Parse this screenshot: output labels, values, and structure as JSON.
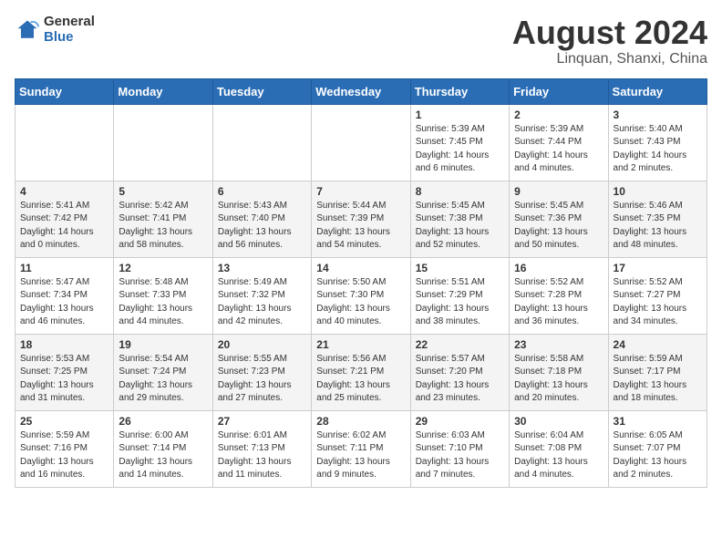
{
  "header": {
    "logo_general": "General",
    "logo_blue": "Blue",
    "month_title": "August 2024",
    "location": "Linquan, Shanxi, China"
  },
  "weekdays": [
    "Sunday",
    "Monday",
    "Tuesday",
    "Wednesday",
    "Thursday",
    "Friday",
    "Saturday"
  ],
  "weeks": [
    [
      {
        "day": "",
        "info": ""
      },
      {
        "day": "",
        "info": ""
      },
      {
        "day": "",
        "info": ""
      },
      {
        "day": "",
        "info": ""
      },
      {
        "day": "1",
        "info": "Sunrise: 5:39 AM\nSunset: 7:45 PM\nDaylight: 14 hours\nand 6 minutes."
      },
      {
        "day": "2",
        "info": "Sunrise: 5:39 AM\nSunset: 7:44 PM\nDaylight: 14 hours\nand 4 minutes."
      },
      {
        "day": "3",
        "info": "Sunrise: 5:40 AM\nSunset: 7:43 PM\nDaylight: 14 hours\nand 2 minutes."
      }
    ],
    [
      {
        "day": "4",
        "info": "Sunrise: 5:41 AM\nSunset: 7:42 PM\nDaylight: 14 hours\nand 0 minutes."
      },
      {
        "day": "5",
        "info": "Sunrise: 5:42 AM\nSunset: 7:41 PM\nDaylight: 13 hours\nand 58 minutes."
      },
      {
        "day": "6",
        "info": "Sunrise: 5:43 AM\nSunset: 7:40 PM\nDaylight: 13 hours\nand 56 minutes."
      },
      {
        "day": "7",
        "info": "Sunrise: 5:44 AM\nSunset: 7:39 PM\nDaylight: 13 hours\nand 54 minutes."
      },
      {
        "day": "8",
        "info": "Sunrise: 5:45 AM\nSunset: 7:38 PM\nDaylight: 13 hours\nand 52 minutes."
      },
      {
        "day": "9",
        "info": "Sunrise: 5:45 AM\nSunset: 7:36 PM\nDaylight: 13 hours\nand 50 minutes."
      },
      {
        "day": "10",
        "info": "Sunrise: 5:46 AM\nSunset: 7:35 PM\nDaylight: 13 hours\nand 48 minutes."
      }
    ],
    [
      {
        "day": "11",
        "info": "Sunrise: 5:47 AM\nSunset: 7:34 PM\nDaylight: 13 hours\nand 46 minutes."
      },
      {
        "day": "12",
        "info": "Sunrise: 5:48 AM\nSunset: 7:33 PM\nDaylight: 13 hours\nand 44 minutes."
      },
      {
        "day": "13",
        "info": "Sunrise: 5:49 AM\nSunset: 7:32 PM\nDaylight: 13 hours\nand 42 minutes."
      },
      {
        "day": "14",
        "info": "Sunrise: 5:50 AM\nSunset: 7:30 PM\nDaylight: 13 hours\nand 40 minutes."
      },
      {
        "day": "15",
        "info": "Sunrise: 5:51 AM\nSunset: 7:29 PM\nDaylight: 13 hours\nand 38 minutes."
      },
      {
        "day": "16",
        "info": "Sunrise: 5:52 AM\nSunset: 7:28 PM\nDaylight: 13 hours\nand 36 minutes."
      },
      {
        "day": "17",
        "info": "Sunrise: 5:52 AM\nSunset: 7:27 PM\nDaylight: 13 hours\nand 34 minutes."
      }
    ],
    [
      {
        "day": "18",
        "info": "Sunrise: 5:53 AM\nSunset: 7:25 PM\nDaylight: 13 hours\nand 31 minutes."
      },
      {
        "day": "19",
        "info": "Sunrise: 5:54 AM\nSunset: 7:24 PM\nDaylight: 13 hours\nand 29 minutes."
      },
      {
        "day": "20",
        "info": "Sunrise: 5:55 AM\nSunset: 7:23 PM\nDaylight: 13 hours\nand 27 minutes."
      },
      {
        "day": "21",
        "info": "Sunrise: 5:56 AM\nSunset: 7:21 PM\nDaylight: 13 hours\nand 25 minutes."
      },
      {
        "day": "22",
        "info": "Sunrise: 5:57 AM\nSunset: 7:20 PM\nDaylight: 13 hours\nand 23 minutes."
      },
      {
        "day": "23",
        "info": "Sunrise: 5:58 AM\nSunset: 7:18 PM\nDaylight: 13 hours\nand 20 minutes."
      },
      {
        "day": "24",
        "info": "Sunrise: 5:59 AM\nSunset: 7:17 PM\nDaylight: 13 hours\nand 18 minutes."
      }
    ],
    [
      {
        "day": "25",
        "info": "Sunrise: 5:59 AM\nSunset: 7:16 PM\nDaylight: 13 hours\nand 16 minutes."
      },
      {
        "day": "26",
        "info": "Sunrise: 6:00 AM\nSunset: 7:14 PM\nDaylight: 13 hours\nand 14 minutes."
      },
      {
        "day": "27",
        "info": "Sunrise: 6:01 AM\nSunset: 7:13 PM\nDaylight: 13 hours\nand 11 minutes."
      },
      {
        "day": "28",
        "info": "Sunrise: 6:02 AM\nSunset: 7:11 PM\nDaylight: 13 hours\nand 9 minutes."
      },
      {
        "day": "29",
        "info": "Sunrise: 6:03 AM\nSunset: 7:10 PM\nDaylight: 13 hours\nand 7 minutes."
      },
      {
        "day": "30",
        "info": "Sunrise: 6:04 AM\nSunset: 7:08 PM\nDaylight: 13 hours\nand 4 minutes."
      },
      {
        "day": "31",
        "info": "Sunrise: 6:05 AM\nSunset: 7:07 PM\nDaylight: 13 hours\nand 2 minutes."
      }
    ]
  ]
}
